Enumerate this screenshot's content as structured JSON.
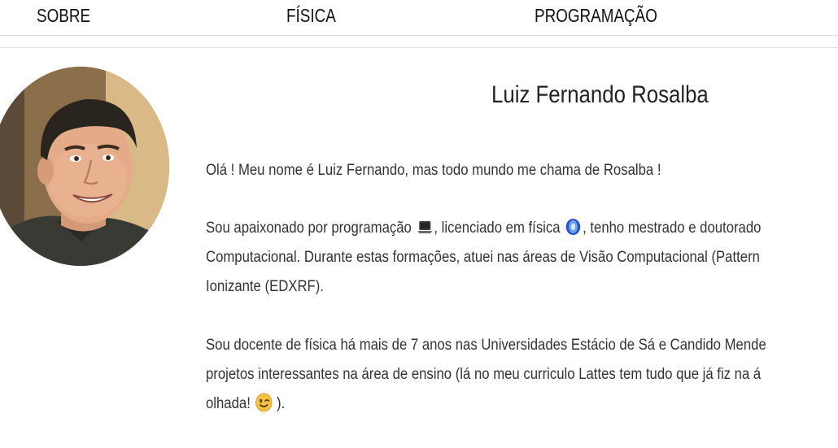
{
  "nav": {
    "items": [
      {
        "label": "SOBRE"
      },
      {
        "label": "FÍSICA"
      },
      {
        "label": "PROGRAMAÇÃO"
      }
    ]
  },
  "profile": {
    "name": "Luiz Fernando Rosalba",
    "avatar_icon": "person-photo"
  },
  "content": {
    "p1": "Olá ! Meu nome é Luiz Fernando, mas todo mundo me chama de Rosalba !",
    "p2_l1_a": "Sou apaixonado por programação ",
    "p2_l1_b": ", licenciado em física ",
    "p2_l1_c": ", tenho mestrado e doutorado",
    "p2_l2": "Computacional. Durante estas formações, atuei nas áreas de Visão Computacional (Pattern",
    "p2_l3": "Ionizante (EDXRF).",
    "p3_l1": "Sou docente de física há mais de 7 anos nas Universidades Estácio de Sá e Candido Mende",
    "p3_l2": "projetos interessantes na área de ensino (lá no meu curriculo Lattes tem tudo que já fiz na á",
    "p3_l3_a": "olhada! ",
    "p3_l3_b": " ).",
    "icons": [
      "laptop-icon",
      "atom-icon",
      "wink-emoji-icon"
    ]
  }
}
